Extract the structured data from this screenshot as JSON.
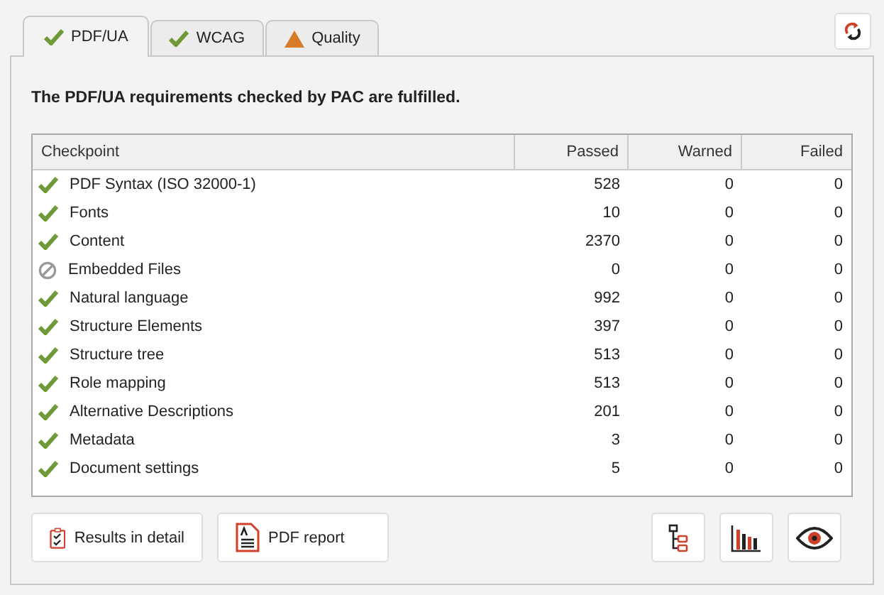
{
  "tabs": [
    {
      "label": "PDF/UA",
      "kind": "passed",
      "selected": true
    },
    {
      "label": "WCAG",
      "kind": "passed",
      "selected": false
    },
    {
      "label": "Quality",
      "kind": "warning",
      "selected": false
    }
  ],
  "heading": "The PDF/UA requirements checked by PAC are fulfilled.",
  "table": {
    "columns": [
      "Checkpoint",
      "Passed",
      "Warned",
      "Failed"
    ],
    "rows": [
      {
        "kind": "passed",
        "cells": [
          "PDF Syntax (ISO 32000-1)",
          "528",
          "0",
          "0"
        ]
      },
      {
        "kind": "passed",
        "cells": [
          "Fonts",
          "10",
          "0",
          "0"
        ]
      },
      {
        "kind": "passed",
        "cells": [
          "Content",
          "2370",
          "0",
          "0"
        ]
      },
      {
        "kind": "skipped",
        "cells": [
          "Embedded Files",
          "0",
          "0",
          "0"
        ]
      },
      {
        "kind": "passed",
        "cells": [
          "Natural language",
          "992",
          "0",
          "0"
        ]
      },
      {
        "kind": "passed",
        "cells": [
          "Structure Elements",
          "397",
          "0",
          "0"
        ]
      },
      {
        "kind": "passed",
        "cells": [
          "Structure tree",
          "513",
          "0",
          "0"
        ]
      },
      {
        "kind": "passed",
        "cells": [
          "Role mapping",
          "513",
          "0",
          "0"
        ]
      },
      {
        "kind": "passed",
        "cells": [
          "Alternative Descriptions",
          "201",
          "0",
          "0"
        ]
      },
      {
        "kind": "passed",
        "cells": [
          "Metadata",
          "3",
          "0",
          "0"
        ]
      },
      {
        "kind": "passed",
        "cells": [
          "Document settings",
          "5",
          "0",
          "0"
        ]
      }
    ]
  },
  "buttons": [
    "Results in detail",
    "PDF report"
  ]
}
